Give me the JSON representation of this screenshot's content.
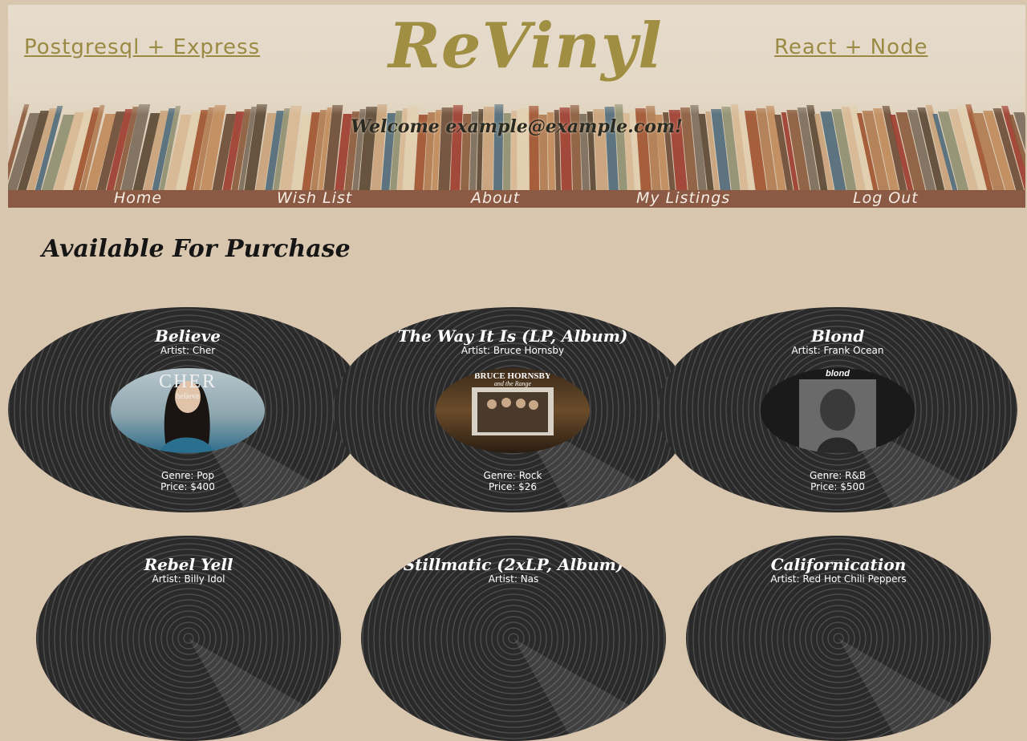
{
  "header": {
    "left_link": "Postgresql + Express",
    "logo": "ReVinyl",
    "right_link": "React + Node",
    "welcome": "Welcome example@example.com!"
  },
  "nav": {
    "items": [
      "Home",
      "Wish List",
      "About",
      "My Listings",
      "Log Out"
    ]
  },
  "main": {
    "section_title": "Available For Purchase",
    "records": [
      {
        "title": "Believe",
        "artist": "Artist: Cher",
        "genre": "Genre: Pop",
        "price": "Price: $400",
        "cover_text": "CHER",
        "cover_sub": "believe"
      },
      {
        "title": "The Way It Is (LP, Album)",
        "artist": "Artist: Bruce Hornsby",
        "genre": "Genre: Rock",
        "price": "Price: $26",
        "cover_text": "BRUCE HORNSBY",
        "cover_sub": "and the Range"
      },
      {
        "title": "Blond",
        "artist": "Artist: Frank Ocean",
        "genre": "Genre: R&B",
        "price": "Price: $500",
        "cover_text": "blond"
      },
      {
        "title": "Rebel Yell",
        "artist": "Artist: Billy Idol"
      },
      {
        "title": "Stillmatic (2xLP, Album)",
        "artist": "Artist: Nas"
      },
      {
        "title": "Californication",
        "artist": "Artist: Red Hot Chili Peppers"
      }
    ]
  }
}
